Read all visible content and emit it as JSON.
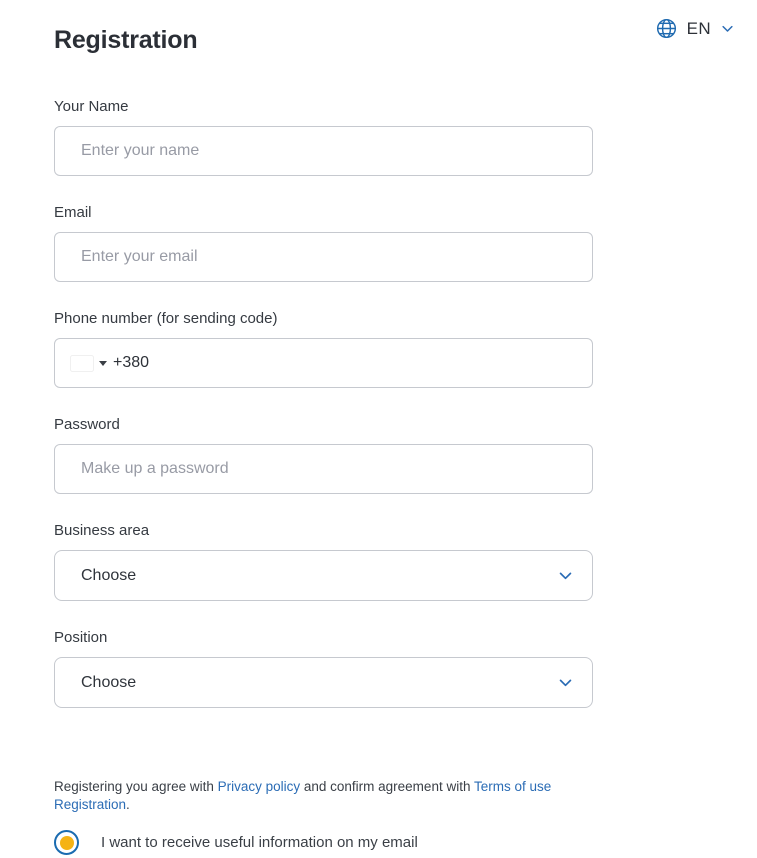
{
  "header": {
    "title": "Registration",
    "language": {
      "code": "EN",
      "globe_icon": "globe-icon",
      "chevron_icon": "chevron-down-icon"
    }
  },
  "colors": {
    "accent_blue": "#2b6cb5",
    "icon_blue": "#1a6bb0",
    "radio_dot": "#f5b314",
    "border": "#c6c9cf",
    "label_text": "#353a41",
    "placeholder": "#989ba5",
    "flag_blue": "#0057b8",
    "flag_yellow": "#ffd700"
  },
  "form": {
    "name": {
      "label": "Your Name",
      "placeholder": "Enter your name",
      "value": ""
    },
    "email": {
      "label": "Email",
      "placeholder": "Enter your email",
      "value": ""
    },
    "phone": {
      "label": "Phone number (for sending code)",
      "country_flag": "ukraine-flag",
      "dial_code": "+380",
      "value": ""
    },
    "password": {
      "label": "Password",
      "placeholder": "Make up a password",
      "value": ""
    },
    "business_area": {
      "label": "Business area",
      "selected": "Choose",
      "chevron_icon": "chevron-down-icon"
    },
    "position": {
      "label": "Position",
      "selected": "Choose",
      "chevron_icon": "chevron-down-icon"
    }
  },
  "agreement": {
    "text_before": "Registering you agree with ",
    "privacy_link": "Privacy policy",
    "text_middle": " and confirm agreement with ",
    "terms_link": "Terms of use Registration",
    "text_after": "."
  },
  "consent": {
    "checked": true,
    "label": "I want to receive useful information on my email"
  }
}
